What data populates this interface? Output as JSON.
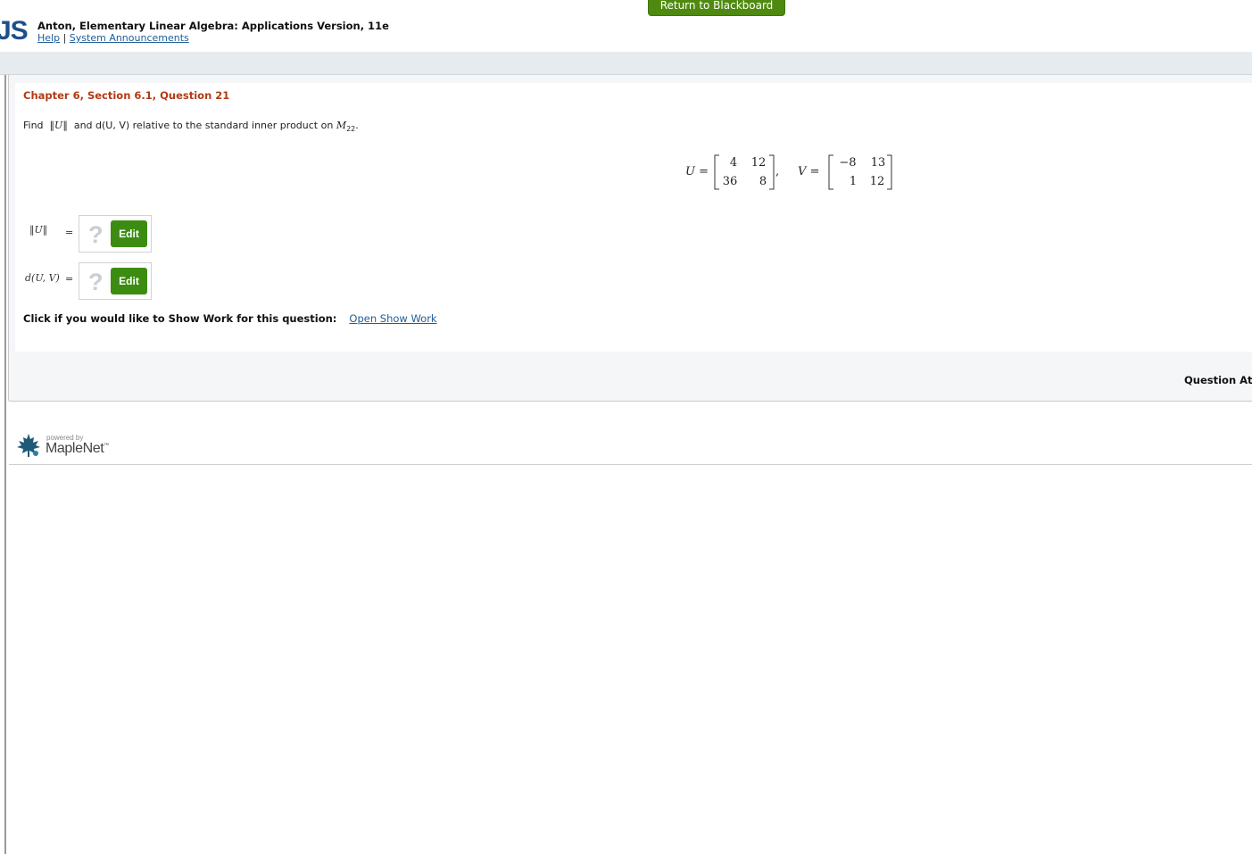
{
  "header": {
    "return_button": "Return to Blackboard",
    "logo_fragment": "JS",
    "book_title": "Anton, Elementary Linear Algebra: Applications Version, 11e",
    "help_link": "Help",
    "separator": "|",
    "announcements_link": "System Announcements"
  },
  "question": {
    "heading": "Chapter 6, Section 6.1, Question 21",
    "prompt_find": "Find",
    "prompt_norm": "‖U‖",
    "prompt_middle": "and d(U, V) relative to the standard inner product on",
    "prompt_space": "M",
    "prompt_space_sub": "22",
    "prompt_end": ".",
    "matrix_u_label": "U =",
    "matrix_u": [
      [
        "4",
        "12"
      ],
      [
        "36",
        "8"
      ]
    ],
    "matrix_v_label": "V =",
    "matrix_v": [
      [
        "−8",
        "13"
      ],
      [
        "1",
        "12"
      ]
    ],
    "answers": [
      {
        "label": "‖U‖",
        "equals": "=",
        "placeholder": "?",
        "edit_label": "Edit"
      },
      {
        "label": "d(U, V)",
        "equals": "=",
        "placeholder": "?",
        "edit_label": "Edit"
      }
    ],
    "show_work_prompt": "Click if you would like to Show Work for this question:",
    "show_work_link": "Open Show Work",
    "attempts_label": "Question Att"
  },
  "footer": {
    "powered_by": "powered by",
    "brand": "MapleNet",
    "brand_mark": "™"
  },
  "colors": {
    "accent_green": "#3c8c12",
    "heading_red": "#b23a14",
    "link_blue": "#1f5d99"
  }
}
